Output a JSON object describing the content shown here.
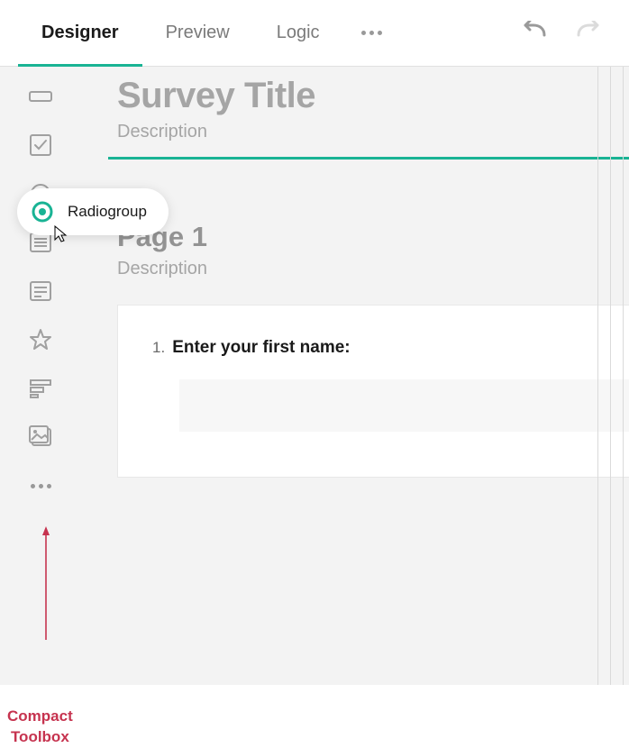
{
  "tabs": {
    "designer": "Designer",
    "preview": "Preview",
    "logic": "Logic"
  },
  "toolbox": {
    "tooltip_label": "Radiogroup"
  },
  "survey": {
    "title_placeholder": "Survey Title",
    "description_placeholder": "Description"
  },
  "page": {
    "title": "Page 1",
    "description_placeholder": "Description"
  },
  "question": {
    "number": "1.",
    "text": "Enter your first name:"
  },
  "annotation": {
    "label": "Compact\nToolbox"
  },
  "colors": {
    "accent": "#19b394",
    "annotation": "#c6334f"
  }
}
